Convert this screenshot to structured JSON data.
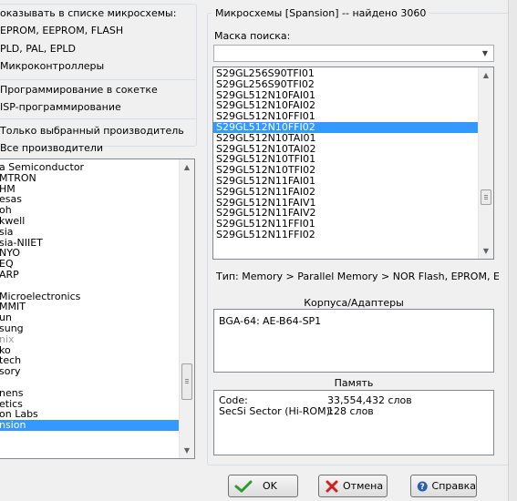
{
  "left": {
    "show_in_list_title": "оказывать в списке микросхемы:",
    "type_options": [
      "EPROM, EEPROM, FLASH",
      "PLD, PAL, EPLD",
      "Микроконтроллеры"
    ],
    "prog_options": [
      "Программирование в сокетке",
      "ISP-программирование"
    ],
    "mfr_options": [
      "Только выбранный производитель",
      "Все производители"
    ],
    "manufacturers": [
      "a Semiconductor",
      "MTRON",
      "HM",
      "esas",
      "oh",
      "kwell",
      "sia",
      "sia-NIIET",
      "NYO",
      "EQ",
      "ARP",
      "",
      "Microelectronics",
      "MMIT",
      "un",
      "sung",
      "nix",
      "ko",
      "tech",
      "sory",
      "",
      "nens",
      "etics",
      "on Labs",
      "nsion"
    ],
    "selected_manufacturer": "nsion"
  },
  "right": {
    "group_title": "Микросхемы [Spansion] -- найдено 3060",
    "search_mask_label": "Маска поиска:",
    "search_mask_value": "",
    "chips": [
      "S29GL256S90TFI01",
      "S29GL256S90TFI02",
      "S29GL512N10FAI01",
      "S29GL512N10FAI02",
      "S29GL512N10FFI01",
      "S29GL512N10FFI02",
      "S29GL512N10TAI01",
      "S29GL512N10TAI02",
      "S29GL512N10TFI01",
      "S29GL512N10TFI02",
      "S29GL512N11FAI01",
      "S29GL512N11FAI02",
      "S29GL512N11FAIV1",
      "S29GL512N11FAIV2",
      "S29GL512N11FFI01",
      "S29GL512N11FFI02"
    ],
    "selected_chip": "S29GL512N10FFI02",
    "type_path": "Тип: Memory > Parallel Memory > NOR Flash, EPROM, EEPROM",
    "packages_title": "Корпуса/Адаптеры",
    "package_name": "BGA-64:",
    "package_adapter": "AE-B64-SP1",
    "memory_title": "Память",
    "memory_rows": [
      {
        "name": "Code:",
        "value": "33,554,432 слов"
      },
      {
        "name": "SecSi Sector (Hi-ROM):",
        "value": "128 слов"
      }
    ]
  },
  "buttons": {
    "ok": "OK",
    "cancel": "Отмена",
    "help": "Справка"
  },
  "colors": {
    "selection": "#3399ff",
    "ok_check": "#2e9a2e",
    "cancel_x": "#d02020",
    "help_icon": "#2a5db0"
  }
}
